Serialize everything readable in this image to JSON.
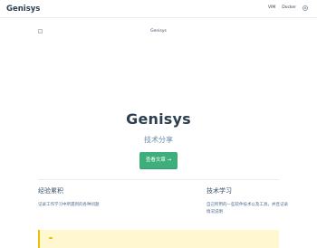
{
  "navbar": {
    "site_name": "Genisys",
    "links": [
      "VIM",
      "Docker"
    ],
    "theme_toggle_icon": "circle-half-icon"
  },
  "hero": {
    "image_alt": "Genisys",
    "image_icon": "broken-image-icon",
    "title": "Genisys",
    "description": "技术分享",
    "action_text": "查看文章 →"
  },
  "features": [
    {
      "title": "经验累积",
      "details": "记录工作学习中所遇到的各种问题"
    },
    {
      "title": "技术学习",
      "details": "自己所用的一些软件技术以及工具，并且记录情况说明"
    }
  ],
  "colors": {
    "accent": "#3eaf7c",
    "text": "#2c3e50",
    "description": "#6a8bad",
    "tip_background": "#fff7d0",
    "tip_border": "#e7c000"
  }
}
